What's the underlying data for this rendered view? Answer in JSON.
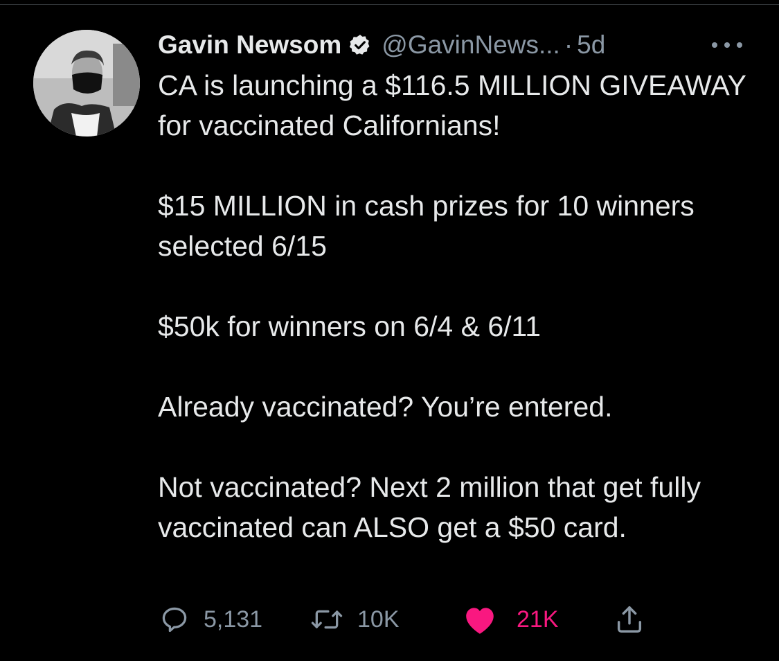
{
  "tweet": {
    "author": {
      "display_name": "Gavin Newsom",
      "handle": "@GavinNews...",
      "verified": true,
      "avatar_icon": "profile-photo"
    },
    "separator": "·",
    "time": "5d",
    "more_icon": "ellipsis-icon",
    "paragraphs": [
      "CA is launching a $116.5 MILLION GIVEAWAY for vaccinated Californians!",
      "$15 MILLION in cash prizes for 10 winners selected 6/15",
      "$50k for winners on 6/4 & 6/11",
      "Already vaccinated? You’re entered.",
      "Not vaccinated? Next 2 million that get fully vaccinated can ALSO get a $50 card."
    ],
    "actions": {
      "reply": {
        "icon": "reply-icon",
        "count": "5,131"
      },
      "retweet": {
        "icon": "retweet-icon",
        "count": "10K"
      },
      "like": {
        "icon": "heart-icon",
        "count": "21K",
        "liked": true
      },
      "share": {
        "icon": "share-icon"
      }
    }
  },
  "colors": {
    "background": "#000000",
    "text": "#e7e9ea",
    "muted": "#8b98a5",
    "like": "#f91880"
  }
}
